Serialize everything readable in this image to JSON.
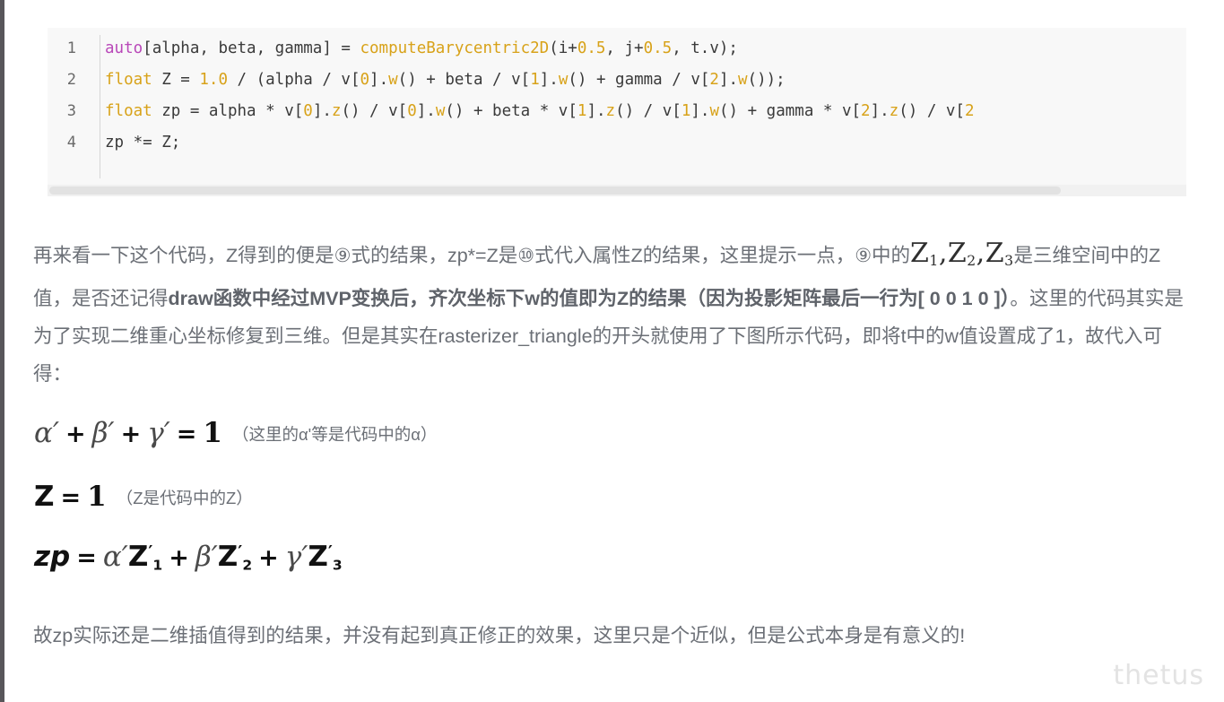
{
  "code_block": {
    "language": "cpp",
    "lines": [
      {
        "number": "1",
        "text": "auto[alpha, beta, gamma] = computeBarycentric2D(i+0.5, j+0.5, t.v);"
      },
      {
        "number": "2",
        "text": "float Z = 1.0 / (alpha / v[0].w() + beta / v[1].w() + gamma / v[2].w());"
      },
      {
        "number": "3",
        "text": "float zp = alpha * v[0].z() / v[0].w() + beta * v[1].z() / v[1].w() + gamma * v[2].z() / v[2"
      },
      {
        "number": "4",
        "text": "zp *= Z;"
      }
    ],
    "colors": {
      "background": "#f8f8f8",
      "keyword": "#b948b9",
      "type": "#d8a219",
      "function": "#d8a219",
      "number": "#d8a219",
      "text": "#3a3a3a",
      "line_number": "#6a6a6a",
      "scrollbar_thumb": "#e2e2e2"
    }
  },
  "prose": {
    "line1_a": "再来看一下这个代码，Z得到的便是",
    "line1_circ9": "⑨",
    "line1_b": "式的结果，zp*=Z是",
    "line1_circ10": "⑩",
    "line1_c": "式代入属性Z的结果，这里提示一点，",
    "line1_circ9b": "⑨",
    "line1_d": "中的",
    "math_z1": "Z",
    "math_z1_sub": "1",
    "math_comma1": ",",
    "math_z2": "Z",
    "math_z2_sub": "2",
    "math_comma2": ",",
    "math_z3": "Z",
    "math_z3_sub": "3",
    "line2_a": "是三维空间中的Z值，是否还记得",
    "line2_bold": "draw函数中经过MVP变换后，齐次坐标下w的值即为Z的结果（因为投影矩阵最后一行为[ 0 0 1 0 ]）",
    "line2_b": "。这里的代码其实是为了实现二维重心坐标修复到三维。但是其实在rasterizer_triangle的开头就使用了下图所示代码，即将t中的w值设置成了1，故代入可得："
  },
  "formulas": [
    {
      "id": "formula-alpha",
      "alpha": "α",
      "prime": "′",
      "plus": "+",
      "beta": "β",
      "gamma": "γ",
      "equals": "=",
      "one": "1",
      "note": "（这里的α'等是代码中的α）"
    },
    {
      "id": "formula-z",
      "z": "Z",
      "equals": "=",
      "one": "1",
      "note": "（Z是代码中的Z）"
    },
    {
      "id": "formula-zp",
      "zp": "zp",
      "equals": "=",
      "alpha": "α",
      "beta": "β",
      "gamma": "γ",
      "prime": "′",
      "z": "Z",
      "sub1": "1",
      "sub2": "2",
      "sub3": "3",
      "plus": "+"
    }
  ],
  "tail": {
    "text": "故zp实际还是二维插值得到的结果，并没有起到真正修正的效果，这里只是个近似，但是公式本身是有意义的!"
  },
  "watermark": {
    "text": "thetus"
  }
}
